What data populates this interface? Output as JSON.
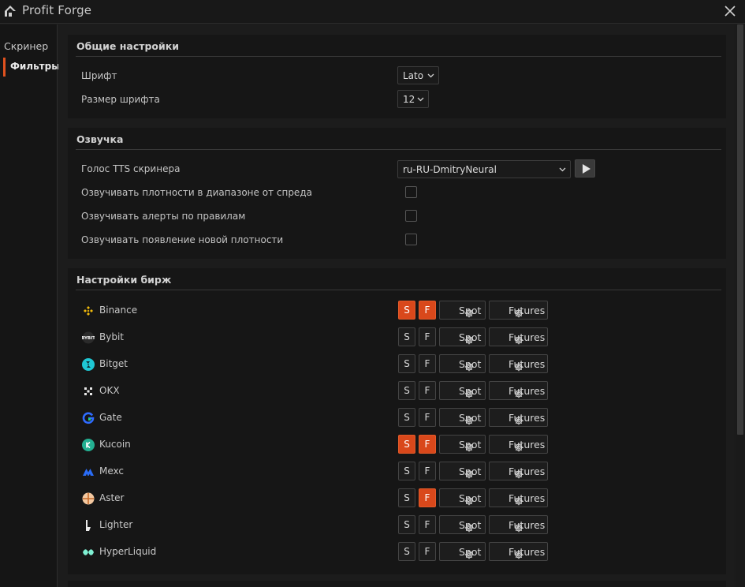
{
  "app": {
    "title": "Profit Forge",
    "logo_icon": "profit-forge-logo",
    "close_icon": "close-icon"
  },
  "sidebar": {
    "group_label": "Скринер",
    "items": [
      {
        "label": "Фильтры",
        "active": true
      }
    ]
  },
  "general": {
    "title": "Общие настройки",
    "font_label": "Шрифт",
    "font_value": "Lato",
    "font_size_label": "Размер шрифта",
    "font_size_value": "12"
  },
  "voice": {
    "title": "Озвучка",
    "tts_label": "Голос TTS скринера",
    "tts_value": "ru-RU-DmitryNeural",
    "play_icon": "play-icon",
    "options": [
      {
        "label": "Озвучивать плотности в диапазоне от спреда",
        "checked": false
      },
      {
        "label": "Озвучивать алерты по правилам",
        "checked": false
      },
      {
        "label": "Озвучивать появление новой плотности",
        "checked": false
      }
    ]
  },
  "exchanges": {
    "title": "Настройки бирж",
    "s_label": "S",
    "f_label": "F",
    "spot_label": "Spot",
    "futures_label": "Futures",
    "active_color": "#d9481b",
    "items": [
      {
        "name": "Binance",
        "icon": "binance-icon",
        "s_on": true,
        "f_on": true
      },
      {
        "name": "Bybit",
        "icon": "bybit-icon",
        "s_on": false,
        "f_on": false
      },
      {
        "name": "Bitget",
        "icon": "bitget-icon",
        "s_on": false,
        "f_on": false
      },
      {
        "name": "OKX",
        "icon": "okx-icon",
        "s_on": false,
        "f_on": false
      },
      {
        "name": "Gate",
        "icon": "gate-icon",
        "s_on": false,
        "f_on": false
      },
      {
        "name": "Kucoin",
        "icon": "kucoin-icon",
        "s_on": true,
        "f_on": true
      },
      {
        "name": "Mexc",
        "icon": "mexc-icon",
        "s_on": false,
        "f_on": false
      },
      {
        "name": "Aster",
        "icon": "aster-icon",
        "s_on": false,
        "f_on": true
      },
      {
        "name": "Lighter",
        "icon": "lighter-icon",
        "s_on": false,
        "f_on": false
      },
      {
        "name": "HyperLiquid",
        "icon": "hyperliquid-icon",
        "s_on": false,
        "f_on": false
      }
    ]
  }
}
